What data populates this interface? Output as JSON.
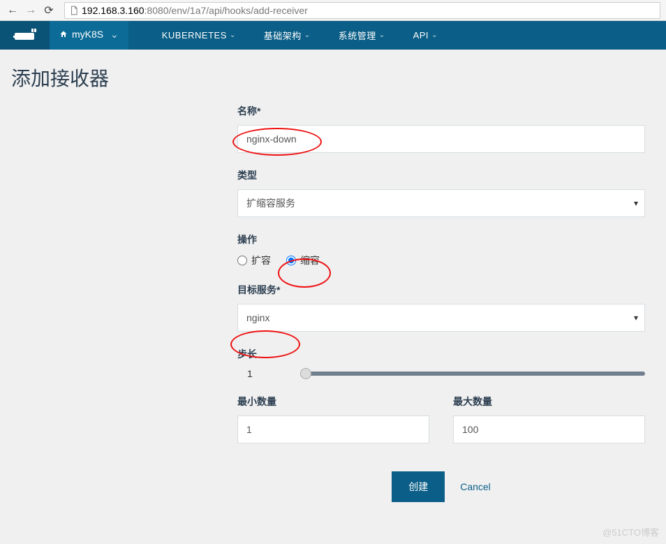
{
  "browser": {
    "url_host": "192.168.3.160",
    "url_port_path": ":8080/env/1a7/api/hooks/add-receiver"
  },
  "nav": {
    "env_name": "myK8S",
    "items": [
      "KUBERNETES",
      "基础架构",
      "系统管理",
      "API"
    ]
  },
  "page": {
    "title": "添加接收器"
  },
  "form": {
    "name_label": "名称*",
    "name_value": "nginx-down",
    "type_label": "类型",
    "type_value": "扩缩容服务",
    "action_label": "操作",
    "action_scale_up": "扩容",
    "action_scale_down": "缩容",
    "action_selected": "scale_down",
    "target_label": "目标服务*",
    "target_value": "nginx",
    "step_label": "步长",
    "step_value": "1",
    "min_label": "最小数量",
    "min_value": "1",
    "max_label": "最大数量",
    "max_value": "100",
    "create_button": "创建",
    "cancel_button": "Cancel"
  },
  "watermark": "@51CTO博客"
}
